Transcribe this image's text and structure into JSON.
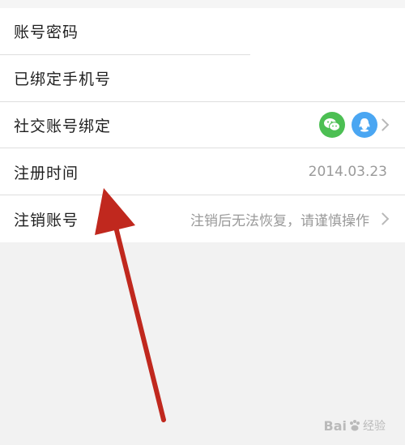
{
  "settings_list": {
    "rows": [
      {
        "label": "账号密码",
        "value": ""
      },
      {
        "label": "已绑定手机号",
        "value": ""
      },
      {
        "label": "社交账号绑定",
        "value": ""
      },
      {
        "label": "注册时间",
        "value": "2014.03.23"
      },
      {
        "label": "注销账号",
        "value": "注销后无法恢复，请谨慎操作"
      }
    ],
    "social_icons": [
      "wechat-icon",
      "qq-icon"
    ]
  },
  "annotation": {
    "arrow_color": "#c0281e"
  },
  "watermark": {
    "brand_left": "Bai",
    "brand_right": "经验",
    "logo_icon": "baidu-paw-icon"
  },
  "colors": {
    "background": "#f2f2f2",
    "row_background": "#ffffff",
    "label_text": "#1f1f1f",
    "value_text": "#9a9a9a",
    "wechat": "#4cbf53",
    "qq": "#4aa6f2"
  }
}
